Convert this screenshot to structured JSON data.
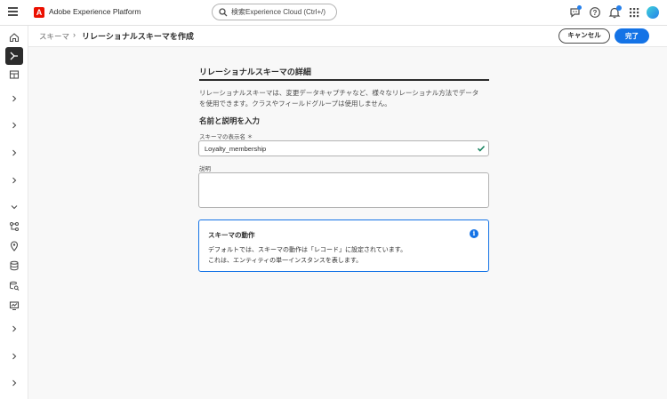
{
  "app": {
    "title": "Adobe Experience Platform",
    "logo_letter": "A",
    "brand_color": "#eb1000"
  },
  "search": {
    "placeholder": "検索Experience Cloud (Ctrl+/)"
  },
  "topbar_icons": [
    "feedback-icon",
    "help-icon",
    "notifications-icon",
    "apps-grid-icon",
    "avatar"
  ],
  "breadcrumb": {
    "parent": "スキーマ",
    "separator": "›",
    "current": "リレーショナルスキーマを作成"
  },
  "actions": {
    "cancel_label": "キャンセル",
    "done_label": "完了",
    "accent": "#1473e6"
  },
  "form": {
    "panel_title": "リレーショナルスキーマの詳細",
    "description_line1": "リレーショナルスキーマは、変更データキャプチャなど、様々なリレーショナル方法でデータ",
    "description_line2": "を使用できます。クラスやフィールドグループは使用しません。",
    "section_heading": "名前と説明を入力",
    "display_name_label": "スキーマの表示名 ＊",
    "display_name_value": "Loyalty_membership",
    "description_label": "説明",
    "description_value": ""
  },
  "info": {
    "title": "スキーマの動作",
    "icon": "info-icon",
    "line1": "デフォルトでは、スキーマの動作は「レコード」に設定されています。",
    "line2": "これは、エンティティの単一インスタンスを表します。"
  },
  "rail": {
    "items": [
      "home-icon",
      "schema-icon",
      "layout-icon",
      "chevron-right-icon",
      "chevron-right-icon",
      "chevron-right-icon",
      "chevron-right-icon",
      "chevron-down-icon",
      "workflow-icon",
      "location-icon",
      "database-icon",
      "data-search-icon",
      "monitor-icon",
      "chevron-right-icon",
      "chevron-right-icon",
      "chevron-right-icon"
    ],
    "active_index": 1
  }
}
